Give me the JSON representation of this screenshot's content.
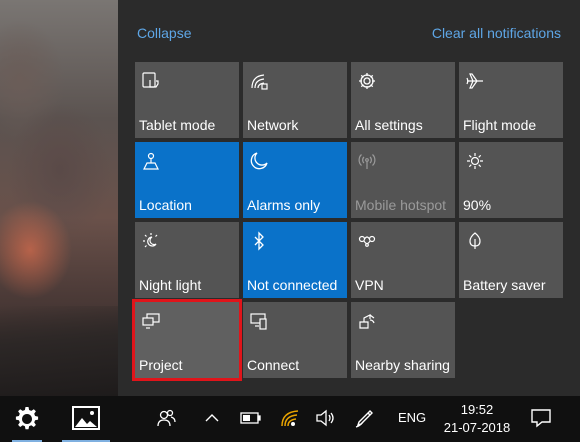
{
  "action_center": {
    "collapse_label": "Collapse",
    "clear_all_label": "Clear all notifications",
    "tiles": [
      {
        "label": "Tablet mode",
        "icon": "tablet-mode-icon",
        "state": "off-normal"
      },
      {
        "label": "Network",
        "icon": "network-icon",
        "state": "normal"
      },
      {
        "label": "All settings",
        "icon": "gear-icon",
        "state": "normal"
      },
      {
        "label": "Flight mode",
        "icon": "airplane-icon",
        "state": "normal"
      },
      {
        "label": "Location",
        "icon": "location-icon",
        "state": "on"
      },
      {
        "label": "Alarms only",
        "icon": "moon-icon",
        "state": "on"
      },
      {
        "label": "Mobile hotspot",
        "icon": "hotspot-icon",
        "state": "disabled"
      },
      {
        "label": "90%",
        "icon": "brightness-icon",
        "state": "normal"
      },
      {
        "label": "Night light",
        "icon": "night-light-icon",
        "state": "normal"
      },
      {
        "label": "Not connected",
        "icon": "bluetooth-icon",
        "state": "on"
      },
      {
        "label": "VPN",
        "icon": "vpn-icon",
        "state": "normal"
      },
      {
        "label": "Battery saver",
        "icon": "battery-saver-icon",
        "state": "normal"
      },
      {
        "label": "Project",
        "icon": "project-icon",
        "state": "highlighted"
      },
      {
        "label": "Connect",
        "icon": "connect-icon",
        "state": "normal"
      },
      {
        "label": "Nearby sharing",
        "icon": "nearby-sharing-icon",
        "state": "normal"
      }
    ]
  },
  "taskbar": {
    "language": "ENG",
    "time": "19:52",
    "date": "21-07-2018"
  },
  "colors": {
    "panel_bg": "#2b2b2b",
    "tile_bg": "#545454",
    "tile_on_bg": "#0a72c9",
    "link": "#5ea6e6",
    "highlight_outline": "#e0141a",
    "taskbar_bg": "#101010"
  }
}
